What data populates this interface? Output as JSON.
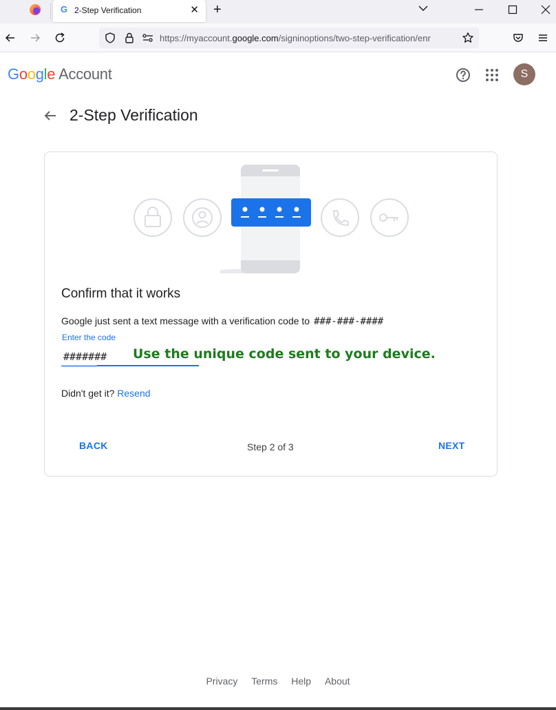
{
  "browser": {
    "tab_title": "2-Step Verification",
    "tab_favicon": "G",
    "url_prefix": "https://myaccount.",
    "url_domain": "google.com",
    "url_path": "/signinoptions/two-step-verification/enr",
    "icons": [
      "firefox-icon",
      "google-favicon",
      "close-icon",
      "plus-icon",
      "chevron-down-icon",
      "minimize-icon",
      "maximize-icon",
      "close-icon",
      "back-arrow-icon",
      "forward-arrow-icon",
      "reload-icon",
      "shield-icon",
      "lock-icon",
      "permissions-icon",
      "star-icon",
      "pocket-icon",
      "menu-icon"
    ]
  },
  "header": {
    "logo_letters": [
      "G",
      "o",
      "o",
      "g",
      "l",
      "e"
    ],
    "logo_suffix": "Account",
    "avatar_letter": "S",
    "icons": [
      "help-icon",
      "apps-grid-icon"
    ]
  },
  "page": {
    "title": "2-Step Verification"
  },
  "card": {
    "heading": "Confirm that it works",
    "description": "Google just sent a text message with a verification code to",
    "masked_phone": "###-###-####",
    "code_label": "Enter the code",
    "code_value": "#######",
    "code_hint": "Use the unique code sent to your device.",
    "resend_prompt": "Didn't get it?",
    "resend_link": "Resend",
    "back_button": "BACK",
    "step_indicator": "Step 2 of 3",
    "next_button": "NEXT",
    "illustration_icons": [
      "lock-icon",
      "person-icon",
      "code-dots-icon",
      "phone-icon",
      "key-icon"
    ]
  },
  "footer": {
    "links": [
      "Privacy",
      "Terms",
      "Help",
      "About"
    ]
  },
  "colors": {
    "accent": "#1a73e8",
    "hint_green": "#1e7b1e",
    "avatar": "#8d6e63"
  }
}
